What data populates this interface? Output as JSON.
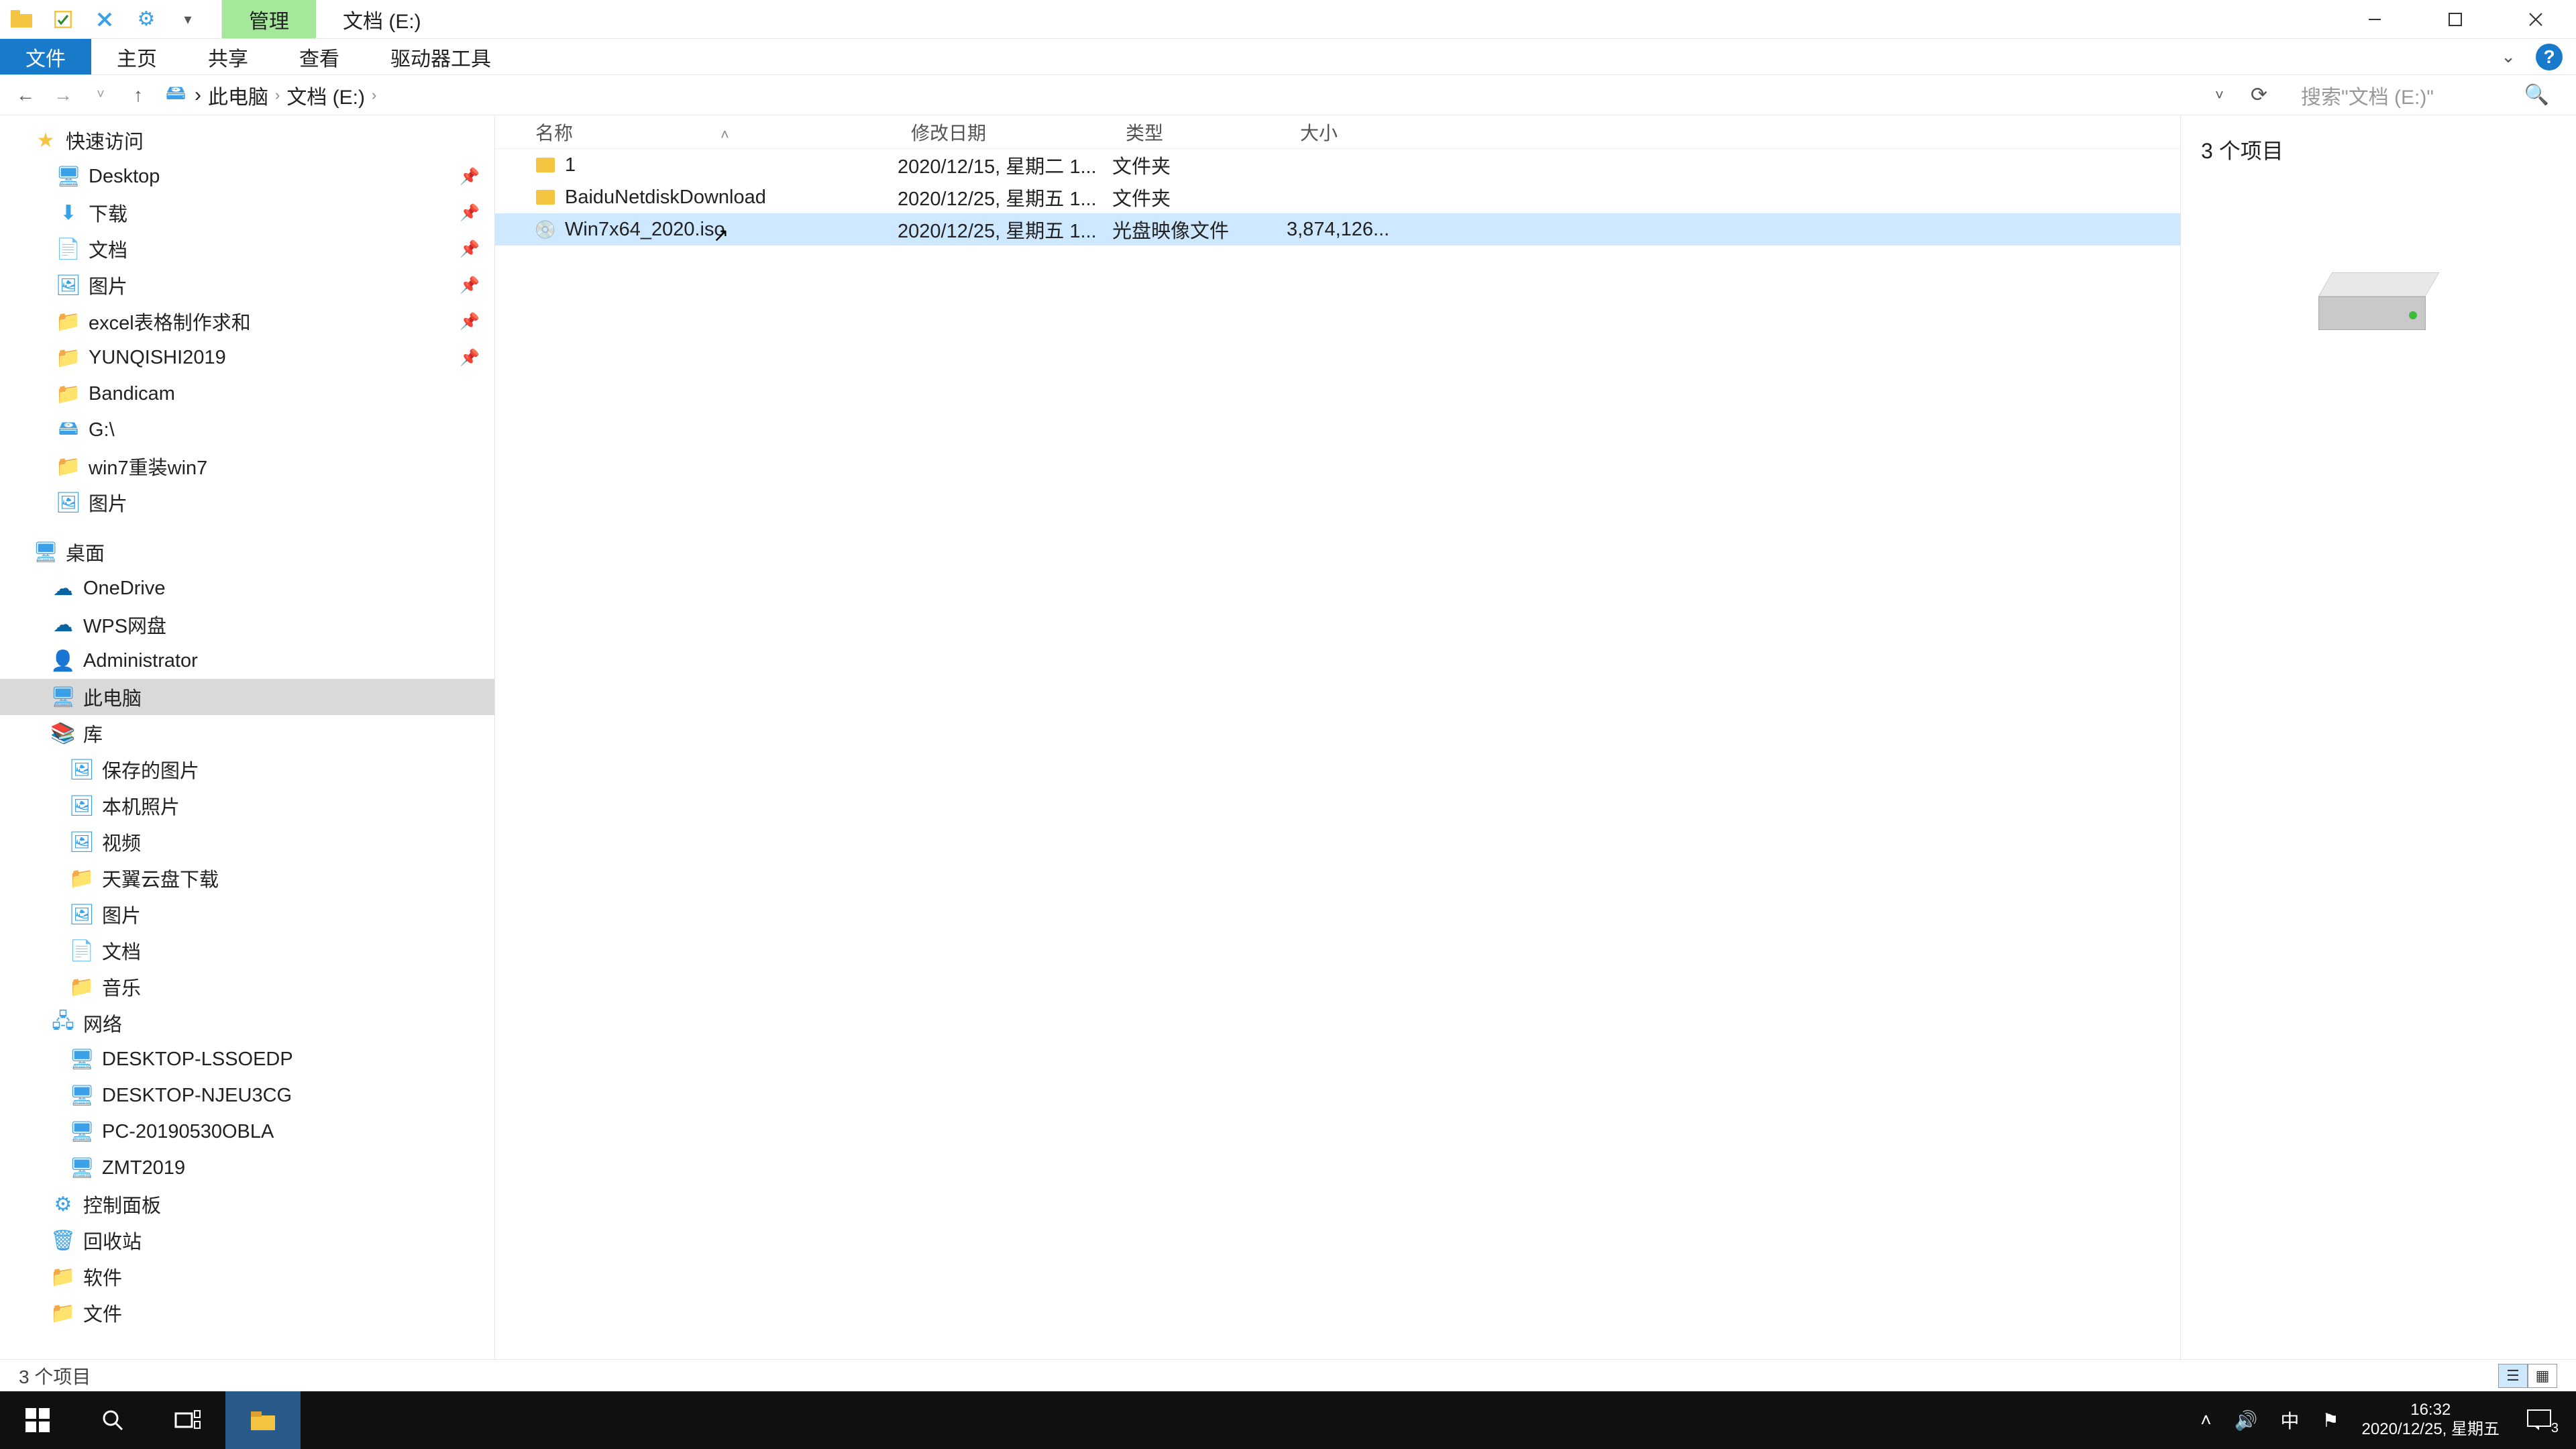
{
  "title": {
    "tool_tab": "管理",
    "window_title": "文档 (E:)"
  },
  "ribbon": {
    "file": "文件",
    "home": "主页",
    "share": "共享",
    "view": "查看",
    "drive_tools": "驱动器工具"
  },
  "address": {
    "crumbs": [
      "此电脑",
      "文档 (E:)"
    ]
  },
  "search": {
    "placeholder": "搜索\"文档 (E:)\""
  },
  "tree": {
    "groups": [
      {
        "padding": 50,
        "pin": false,
        "icon": "i-star",
        "label": "快速访问"
      },
      {
        "padding": 84,
        "pin": true,
        "icon": "i-desk",
        "label": "Desktop"
      },
      {
        "padding": 84,
        "pin": true,
        "icon": "i-dl",
        "label": "下载"
      },
      {
        "padding": 84,
        "pin": true,
        "icon": "i-doc",
        "label": "文档"
      },
      {
        "padding": 84,
        "pin": true,
        "icon": "i-pic",
        "label": "图片"
      },
      {
        "padding": 84,
        "pin": true,
        "icon": "i-folder",
        "label": "excel表格制作求和"
      },
      {
        "padding": 84,
        "pin": true,
        "icon": "i-folder",
        "label": "YUNQISHI2019"
      },
      {
        "padding": 84,
        "pin": false,
        "icon": "i-folder",
        "label": "Bandicam"
      },
      {
        "padding": 84,
        "pin": false,
        "icon": "i-drive",
        "label": "G:\\"
      },
      {
        "padding": 84,
        "pin": false,
        "icon": "i-folder",
        "label": "win7重装win7"
      },
      {
        "padding": 84,
        "pin": false,
        "icon": "i-pic",
        "label": "图片"
      },
      {
        "padding": 50,
        "pin": false,
        "icon": "",
        "label": "",
        "spacer": true
      },
      {
        "padding": 50,
        "pin": false,
        "icon": "i-desk",
        "label": "桌面"
      },
      {
        "padding": 76,
        "pin": false,
        "icon": "i-od",
        "label": "OneDrive"
      },
      {
        "padding": 76,
        "pin": false,
        "icon": "i-od",
        "label": "WPS网盘"
      },
      {
        "padding": 76,
        "pin": false,
        "icon": "i-user",
        "label": "Administrator"
      },
      {
        "padding": 76,
        "pin": false,
        "icon": "i-pc",
        "label": "此电脑",
        "sel": true
      },
      {
        "padding": 76,
        "pin": false,
        "icon": "i-lib",
        "label": "库"
      },
      {
        "padding": 104,
        "pin": false,
        "icon": "i-pic",
        "label": "保存的图片"
      },
      {
        "padding": 104,
        "pin": false,
        "icon": "i-pic",
        "label": "本机照片"
      },
      {
        "padding": 104,
        "pin": false,
        "icon": "i-pic",
        "label": "视频"
      },
      {
        "padding": 104,
        "pin": false,
        "icon": "i-folder",
        "label": "天翼云盘下载"
      },
      {
        "padding": 104,
        "pin": false,
        "icon": "i-pic",
        "label": "图片"
      },
      {
        "padding": 104,
        "pin": false,
        "icon": "i-doc",
        "label": "文档"
      },
      {
        "padding": 104,
        "pin": false,
        "icon": "i-folder",
        "label": "音乐"
      },
      {
        "padding": 76,
        "pin": false,
        "icon": "i-net",
        "label": "网络"
      },
      {
        "padding": 104,
        "pin": false,
        "icon": "i-npc",
        "label": "DESKTOP-LSSOEDP"
      },
      {
        "padding": 104,
        "pin": false,
        "icon": "i-npc",
        "label": "DESKTOP-NJEU3CG"
      },
      {
        "padding": 104,
        "pin": false,
        "icon": "i-npc",
        "label": "PC-20190530OBLA"
      },
      {
        "padding": 104,
        "pin": false,
        "icon": "i-npc",
        "label": "ZMT2019"
      },
      {
        "padding": 76,
        "pin": false,
        "icon": "i-cp",
        "label": "控制面板"
      },
      {
        "padding": 76,
        "pin": false,
        "icon": "i-bin",
        "label": "回收站"
      },
      {
        "padding": 76,
        "pin": false,
        "icon": "i-folder",
        "label": "软件"
      },
      {
        "padding": 76,
        "pin": false,
        "icon": "i-folder",
        "label": "文件"
      }
    ]
  },
  "columns": {
    "name": "名称",
    "date": "修改日期",
    "type": "类型",
    "size": "大小"
  },
  "files": [
    {
      "icon": "folder",
      "name": "1",
      "date": "2020/12/15, 星期二 1...",
      "type": "文件夹",
      "size": "",
      "sel": false
    },
    {
      "icon": "folder",
      "name": "BaiduNetdiskDownload",
      "date": "2020/12/25, 星期五 1...",
      "type": "文件夹",
      "size": "",
      "sel": false
    },
    {
      "icon": "disc",
      "name": "Win7x64_2020.iso",
      "date": "2020/12/25, 星期五 1...",
      "type": "光盘映像文件",
      "size": "3,874,126...",
      "sel": true,
      "cursor": true
    }
  ],
  "preview": {
    "count": "3 个项目"
  },
  "status": {
    "text": "3 个项目"
  },
  "taskbar": {
    "time": "16:32",
    "date": "2020/12/25, 星期五",
    "ime": "中",
    "notif_count": "3"
  }
}
